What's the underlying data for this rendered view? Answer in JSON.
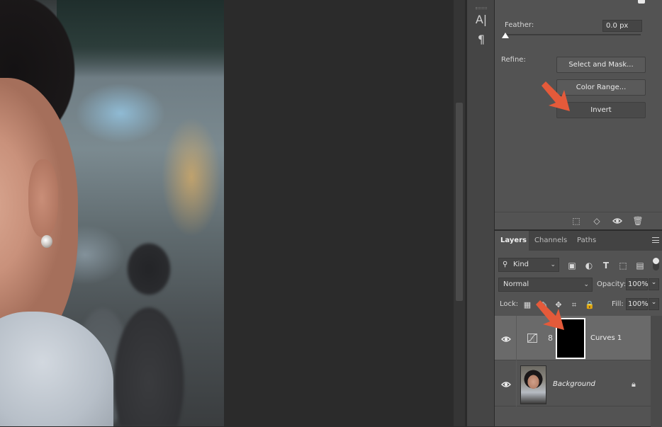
{
  "properties": {
    "feather_label": "Feather:",
    "feather_value": "0.0 px",
    "refine_label": "Refine:",
    "buttons": {
      "select_and_mask": "Select and Mask...",
      "color_range": "Color Range...",
      "invert": "Invert"
    },
    "footer_icons": [
      "selection-icon",
      "apply-mask-icon",
      "visibility-icon",
      "trash-icon"
    ]
  },
  "tool_strip": {
    "icons": [
      "character-icon",
      "paragraph-icon"
    ],
    "character_glyph": "A|",
    "paragraph_glyph": "¶"
  },
  "layers_panel": {
    "tabs": [
      "Layers",
      "Channels",
      "Paths"
    ],
    "active_tab": "Layers",
    "filter": {
      "kind": "Kind"
    },
    "blend_mode": "Normal",
    "opacity_label": "Opacity:",
    "opacity_value": "100%",
    "lock_label": "Lock:",
    "fill_label": "Fill:",
    "fill_value": "100%",
    "layers": [
      {
        "name": "Curves 1",
        "type": "adjustment",
        "visible": true,
        "selected": true
      },
      {
        "name": "Background",
        "type": "image",
        "visible": true,
        "locked": true
      }
    ]
  },
  "colors": {
    "accent_arrow": "#e45a3a",
    "panel_bg": "#535353",
    "selected_row": "#6a6a6a"
  }
}
